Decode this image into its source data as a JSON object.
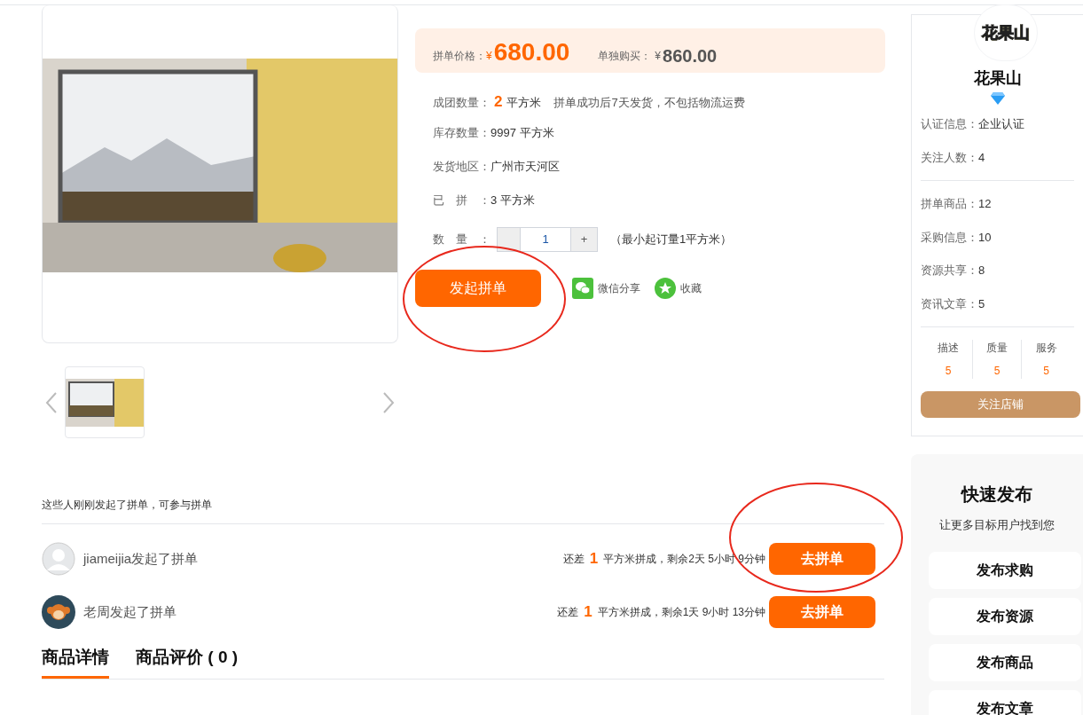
{
  "price": {
    "group_label": "拼单价格：",
    "group_currency": "¥",
    "group_price": "680.00",
    "solo_label": "单独购买：",
    "solo_currency": "¥",
    "solo_price": "860.00"
  },
  "specs": [
    {
      "kind": "highlight",
      "label": "成团数量：",
      "value": "2",
      "unit": "平方米",
      "note": "拼单成功后7天发货，不包括物流运费"
    },
    {
      "kind": "plain",
      "label": "库存数量：",
      "value": "9997 平方米"
    },
    {
      "kind": "plain",
      "label": "发货地区：",
      "value": "广州市天河区"
    },
    {
      "kind": "plain",
      "label": "已　拼　：",
      "value": "3 平方米"
    }
  ],
  "quantity": {
    "label": "数　量　：",
    "value": "1",
    "plus": "+",
    "note": "（最小起订量1平方米）"
  },
  "actions": {
    "start": "发起拼单",
    "share": "微信分享",
    "favorite": "收藏"
  },
  "groups": {
    "title": "这些人刚刚发起了拼单，可参与拼单",
    "rows": [
      {
        "kind": "silhouette",
        "user": "jiameijia发起了拼单",
        "prefix": "还差",
        "missing": "1",
        "suffix": "平方米拼成，剩余2天 5小时 9分钟",
        "button": "去拼单"
      },
      {
        "kind": "monkey",
        "user": "老周发起了拼单",
        "prefix": "还差",
        "missing": "1",
        "suffix": "平方米拼成，剩余1天 9小时 13分钟",
        "button": "去拼单"
      }
    ]
  },
  "tabs": [
    {
      "label": "商品详情",
      "selected": true
    },
    {
      "label": "商品评价 ( 0 )",
      "selected": false
    }
  ],
  "shop": {
    "logo": "花果山",
    "name": "花果山",
    "info": [
      [
        {
          "label": "认证信息：",
          "value": "企业认证"
        },
        {
          "label": "关注人数：",
          "value": "4"
        }
      ],
      [
        {
          "label": "拼单商品：",
          "value": "12"
        },
        {
          "label": "采购信息：",
          "value": "10"
        },
        {
          "label": "资源共享：",
          "value": "8"
        },
        {
          "label": "资讯文章：",
          "value": "5"
        }
      ]
    ],
    "ratings": [
      {
        "label": "描述",
        "value": "5"
      },
      {
        "label": "质量",
        "value": "5"
      },
      {
        "label": "服务",
        "value": "5"
      }
    ],
    "follow": "关注店铺"
  },
  "quick_publish": {
    "title": "快速发布",
    "subtitle": "让更多目标用户找到您",
    "buttons": [
      "发布求购",
      "发布资源",
      "发布商品",
      "发布文章"
    ]
  }
}
